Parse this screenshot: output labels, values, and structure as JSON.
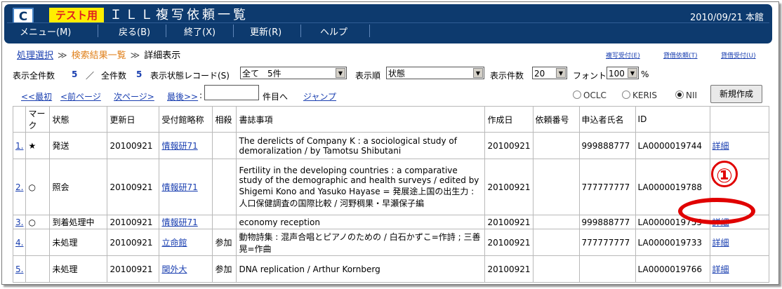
{
  "header": {
    "logo": "C",
    "test_badge": "テスト用",
    "title": "ＩＬＬ複写依頼一覧",
    "date_location": "2010/09/21 本館"
  },
  "menu": {
    "items": [
      "メニュー(M)",
      "戻る(B)",
      "終了(X)",
      "更新(R)",
      "ヘルプ"
    ]
  },
  "breadcrumb": {
    "step1": "処理選択",
    "sep": "≫",
    "step2": "検索結果一覧",
    "current": "詳細表示"
  },
  "right_links": [
    "複写受付(E)",
    "貸借依頼(T)",
    "貸借受付(U)"
  ],
  "controls": {
    "total_label": "表示全件数",
    "total_value": "5",
    "slash": "／",
    "all_label": "全件数",
    "all_value": "5",
    "status_record_label": "表示状態レコード(S)",
    "status_record_value": "全て　5件",
    "sort_label": "表示順",
    "sort_value": "状態",
    "count_label": "表示件数",
    "count_value": "20",
    "font_label": "フォント",
    "font_value": "100",
    "font_unit": "%"
  },
  "nav": {
    "first": "<<最初",
    "prev": "<前ページ",
    "next": "次ページ>",
    "last": "最後>>",
    "colon": ":",
    "jump_input": "",
    "goto_label": "件目へ",
    "jump": "ジャンプ",
    "radio_oclc": "OCLC",
    "radio_keris": "KERIS",
    "radio_nii": "NII",
    "selected": "NII",
    "new_button": "新規作成"
  },
  "table": {
    "columns": [
      "",
      "マーク",
      "状態",
      "更新日",
      "受付館略称",
      "相殺",
      "書誌事項",
      "作成日",
      "依頼番号",
      "申込者氏名",
      "ID",
      ""
    ],
    "rows": [
      {
        "no": "1.",
        "mark": "★",
        "status": "発送",
        "updated": "20100921",
        "library": "情報研71",
        "offset": "",
        "bib": "The derelicts of Company K : a sociological study of demoralization / by Tamotsu Shibutani",
        "created": "20100921",
        "request_no": "",
        "applicant": "999888777",
        "id": "LA0000019744",
        "detail": "詳細"
      },
      {
        "no": "2.",
        "mark": "○",
        "status": "照会",
        "updated": "20100921",
        "library": "情報研71",
        "offset": "",
        "bib": "Fertility in the developing countries : a comparative study of the demographic and health surveys / edited by Shigemi Kono and Yasuko Hayase = 発展途上国の出生力 : 人口保健調査の国際比較 / 河野稠果・早瀬保子編",
        "created": "20100921",
        "request_no": "",
        "applicant": "777777777",
        "id": "LA0000019788",
        "detail": ""
      },
      {
        "no": "3.",
        "mark": "○",
        "status": "到着処理中",
        "updated": "20100921",
        "library": "情報研71",
        "offset": "",
        "bib": "economy reception",
        "created": "20100921",
        "request_no": "",
        "applicant": "999888777",
        "id": "LA0000019755",
        "detail": "詳細"
      },
      {
        "no": "4.",
        "mark": "",
        "status": "未処理",
        "updated": "20100921",
        "library": "立命館",
        "offset": "参加",
        "bib": "動物詩集 : 混声合唱とピアノのための / 白石かずこ=作詩 ; 三善晃=作曲",
        "created": "20100921",
        "request_no": "",
        "applicant": "777777777",
        "id": "LA0000019733",
        "detail": "詳細"
      },
      {
        "no": "5.",
        "mark": "",
        "status": "未処理",
        "updated": "20100921",
        "library": "関外大",
        "offset": "参加",
        "bib": "DNA replication / Arthur Kornberg",
        "created": "20100921",
        "request_no": "",
        "applicant": "",
        "id": "LA0000019766",
        "detail": "詳細"
      }
    ]
  },
  "annotation": {
    "number": "①",
    "color": "#e00000"
  },
  "colors": {
    "header_bg": "#0d3a6e",
    "link": "#1a3fb0",
    "badge": "#ffee00",
    "breadcrumb_active": "#e0801b"
  }
}
